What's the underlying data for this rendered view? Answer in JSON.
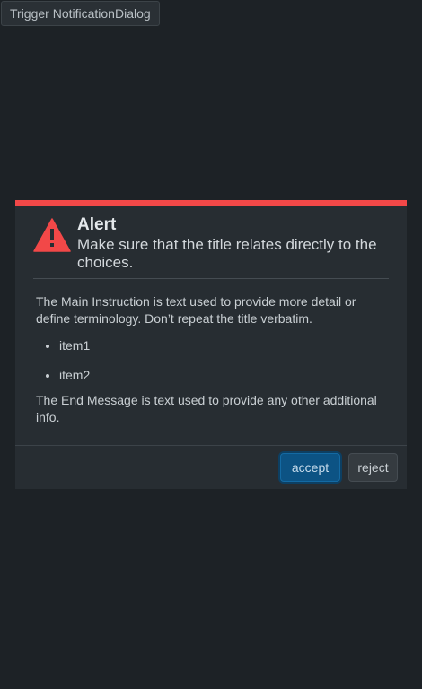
{
  "trigger": {
    "label": "Trigger NotificationDialog"
  },
  "dialog": {
    "title": "Alert",
    "subtitle": "Make sure that the title relates directly to the choices.",
    "main_instruction": "The Main Instruction is text used to provide more detail or define terminology. Don’t repeat the title verbatim.",
    "items": [
      "item1",
      "item2"
    ],
    "end_message": "The End Message is text used to provide any other additional info.",
    "icon": "warning-triangle-icon",
    "accent_color": "#f24848",
    "buttons": {
      "accept": "accept",
      "reject": "reject"
    }
  }
}
